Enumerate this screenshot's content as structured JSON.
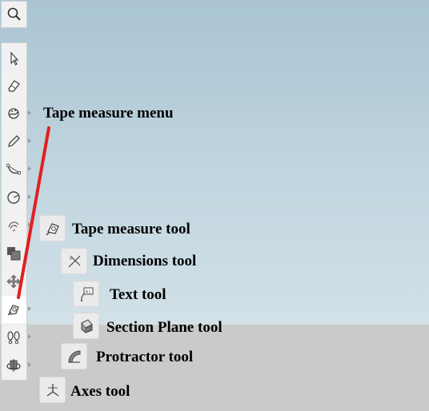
{
  "toolbar": {
    "tools": [
      "search-icon",
      "select-icon",
      "eraser-icon",
      "paint-bucket-icon",
      "pencil-icon",
      "arc-icon",
      "circle-icon",
      "push-pull-icon",
      "offset-icon",
      "move-icon",
      "tape-measure-icon",
      "walk-icon",
      "orbit-icon"
    ],
    "active_tool": "tape-measure-icon"
  },
  "annotations": {
    "tape_menu_title": "Tape measure menu",
    "items": [
      {
        "icon": "tape-measure-icon",
        "label": "Tape measure tool"
      },
      {
        "icon": "dimensions-icon",
        "label": "Dimensions tool"
      },
      {
        "icon": "text-icon",
        "label": "Text tool"
      },
      {
        "icon": "section-plane-icon",
        "label": "Section Plane tool"
      },
      {
        "icon": "protractor-icon",
        "label": "Protractor tool"
      },
      {
        "icon": "axes-icon",
        "label": "Axes tool"
      }
    ],
    "pointer_color": "#e02020"
  },
  "colors": {
    "sky": "#bcd1dc",
    "ground": "#cacac8",
    "toolbar": "#f1f1f1"
  }
}
